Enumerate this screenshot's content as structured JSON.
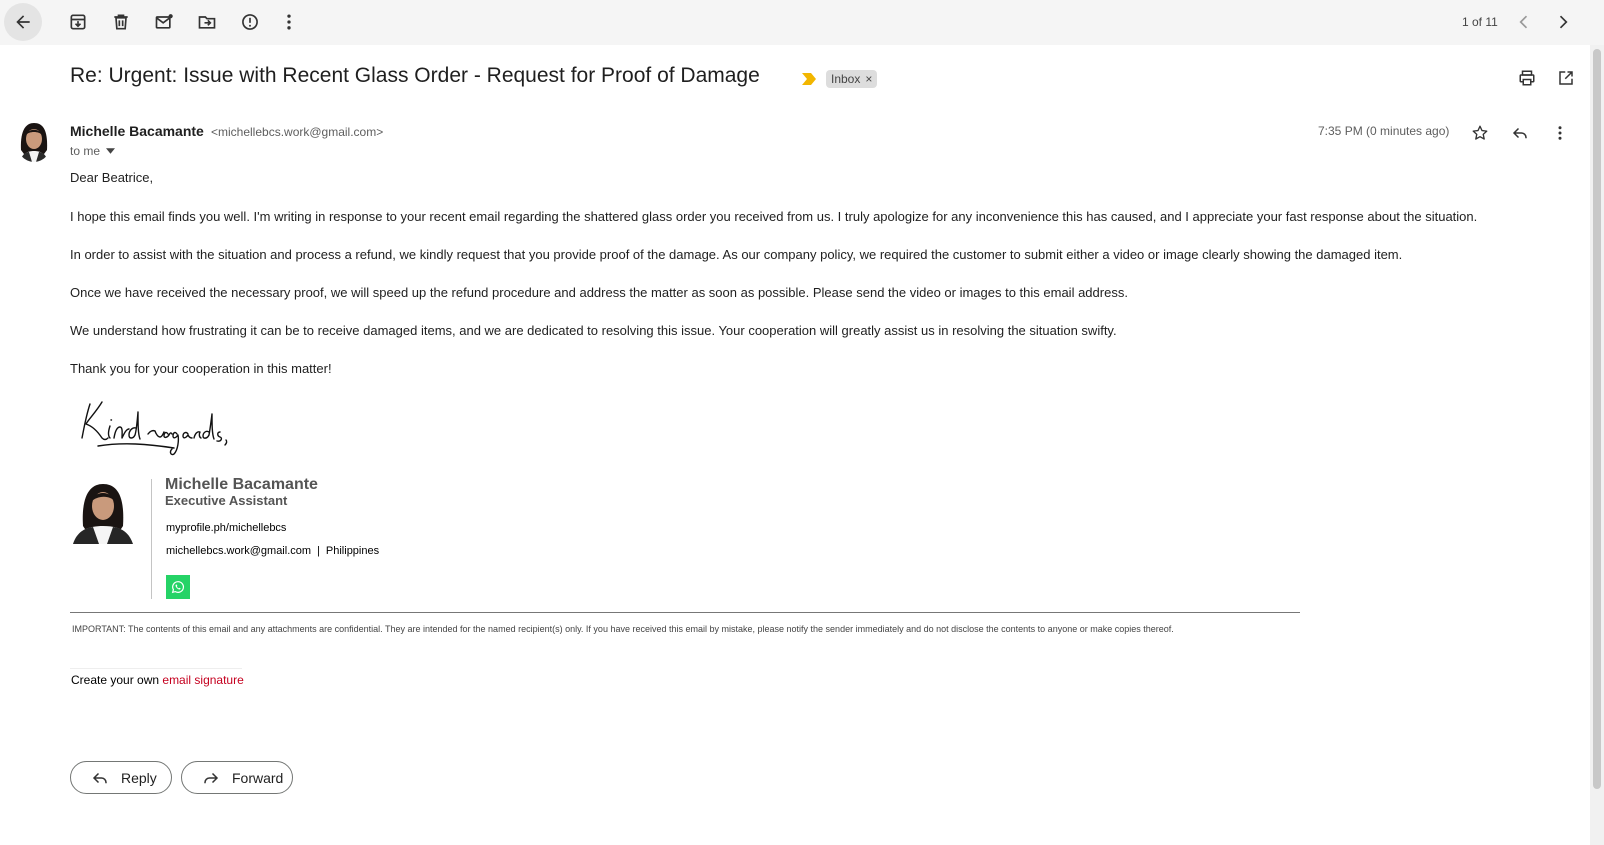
{
  "toolbar": {
    "icons": [
      "back-arrow-icon",
      "archive-icon",
      "trash-icon",
      "mark-unread-icon",
      "move-to-icon",
      "report-spam-icon",
      "more-vert-icon"
    ],
    "pager_text": "1 of 11"
  },
  "email": {
    "subject": "Re: Urgent: Issue with Recent Glass Order - Request for Proof of Damage",
    "label": "Inbox",
    "label_remove": "×",
    "sender_name": "Michelle Bacamante",
    "sender_email": "<michellebcs.work@gmail.com>",
    "to_text": "to me",
    "timestamp": "7:35 PM (0 minutes ago)",
    "body": {
      "greeting": "Dear Beatrice,",
      "p1": "I hope this email finds you well. I'm writing in response to your recent email regarding the shattered glass order you received from us. I truly apologize for any inconvenience this has caused, and I appreciate your fast response about the situation.",
      "p2": "In order to assist with the situation and process a refund, we kindly request that you provide proof of the damage. As our company policy, we required the customer to submit either a video or image clearly showing the damaged item.",
      "p3": "Once we have received the necessary proof, we will speed up the refund procedure and address the matter as soon as possible. Please send the video or images to this email address.",
      "p4": "We understand how frustrating it can be to receive damaged items, and we are dedicated to resolving this issue. Your cooperation will greatly assist us in resolving the situation swifty.",
      "p5": "Thank you for your cooperation in this matter!"
    },
    "signature": {
      "closing_image_text": "Kind regards,",
      "name": "Michelle Bacamante",
      "title": "Executive Assistant",
      "link": "myprofile.ph/michellebcs",
      "email": "michellebcs.work@gmail.com",
      "separator": "|",
      "location": "Philippines"
    },
    "disclaimer": "IMPORTANT: The contents of this email and any attachments are confidential. They are intended for the named recipient(s) only. If you have received this email by mistake, please notify the sender immediately and do not disclose the contents to anyone or make copies thereof.",
    "create_sig_prefix": "Create your own ",
    "create_sig_link": "email signature"
  },
  "actions": {
    "reply_label": "Reply",
    "forward_label": "Forward"
  },
  "colors": {
    "topbar_bg": "#f5f5f5",
    "importance_marker": "#f2b600",
    "whatsapp": "#25d366",
    "link_red": "#c5001f"
  }
}
